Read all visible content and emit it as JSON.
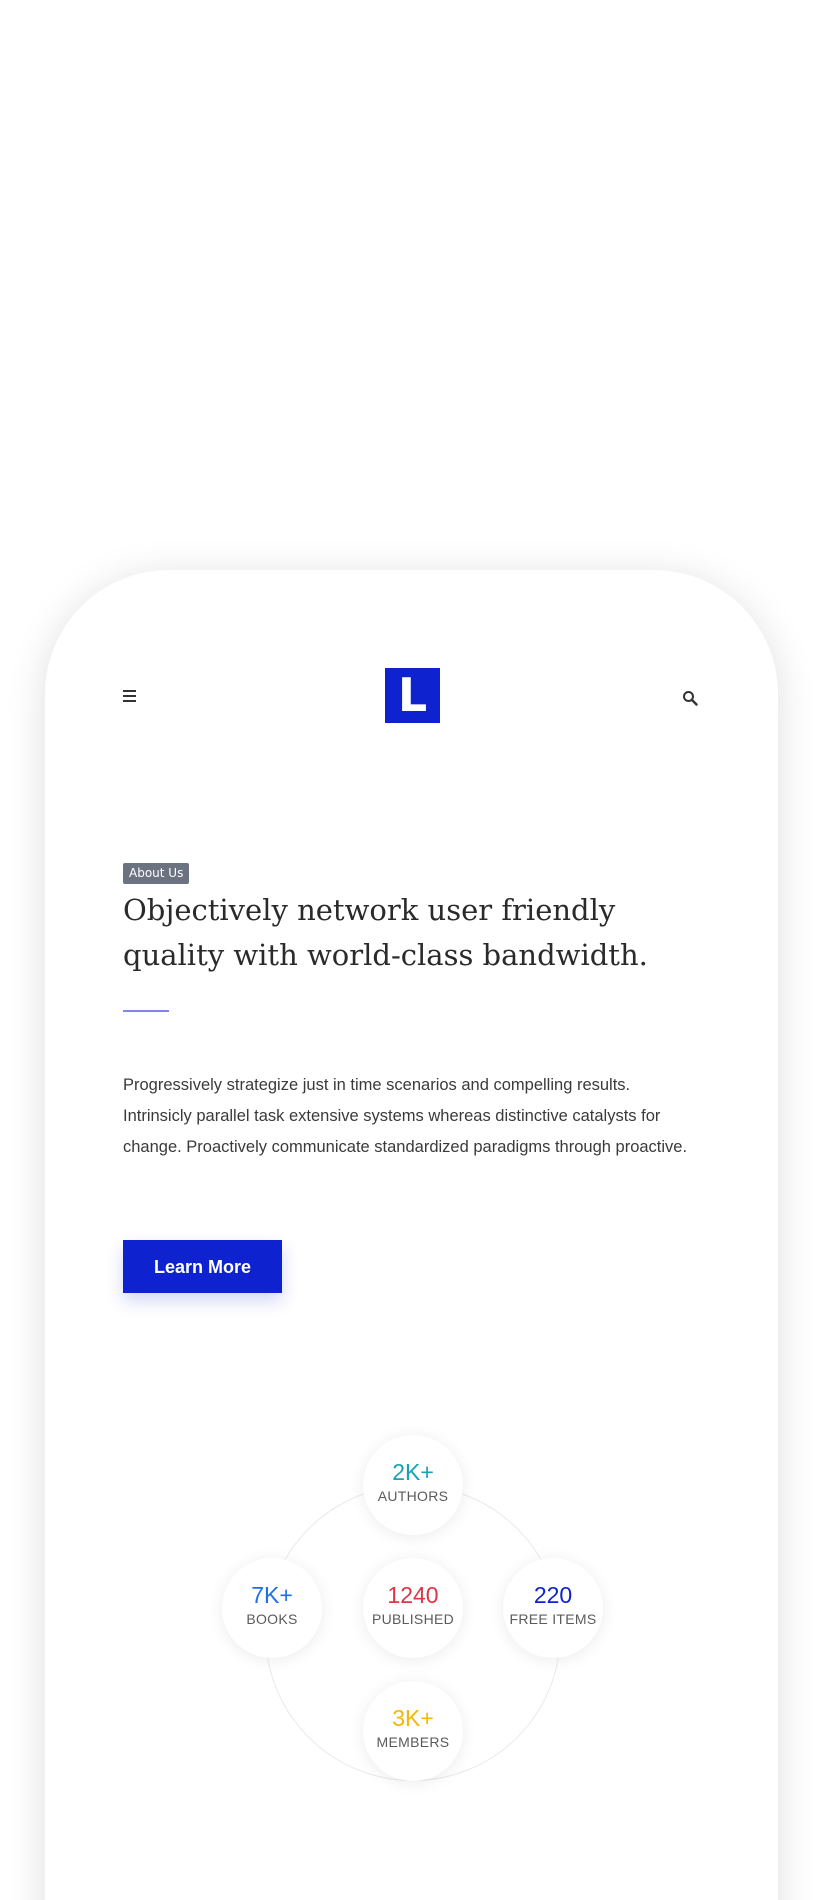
{
  "logo": {
    "letter": "L",
    "color": "#0f22cf"
  },
  "header": {
    "menu_icon": "hamburger-icon",
    "search_icon": "search-icon"
  },
  "about": {
    "eyebrow": "About Us",
    "headline": "Objectively network user friendly quality with world-class bandwidth.",
    "body": "Progressively strategize just in time scenarios and compelling results. Intrinsicly parallel task extensive systems whereas distinctive catalysts for change. Proactively communicate standardized paradigms through proactive.",
    "cta_label": "Learn More",
    "accent": "#0f22cf"
  },
  "stats": [
    {
      "value": "2K+",
      "label": "AUTHORS",
      "color": "#17a2b8"
    },
    {
      "value": "7K+",
      "label": "BOOKS",
      "color": "#1e6ee8"
    },
    {
      "value": "1240",
      "label": "PUBLISHED",
      "color": "#dc3545"
    },
    {
      "value": "220",
      "label": "FREE ITEMS",
      "color": "#0f22cf"
    },
    {
      "value": "3K+",
      "label": "MEMBERS",
      "color": "#f5b800"
    }
  ]
}
